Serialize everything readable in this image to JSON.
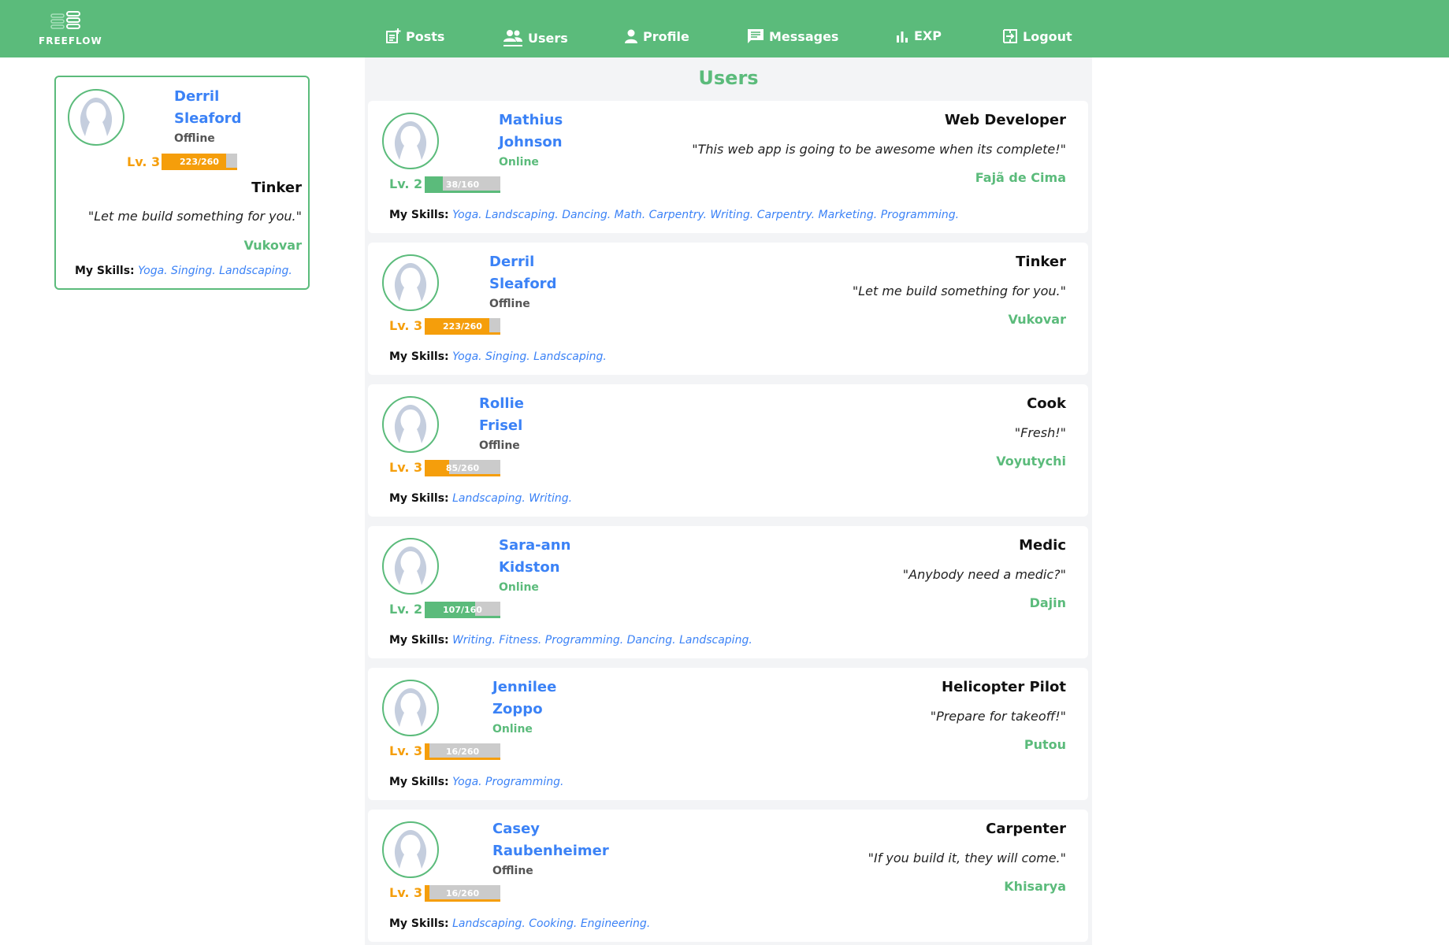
{
  "app": {
    "logo_text": "FREEFLOW"
  },
  "nav": [
    {
      "label": "Posts",
      "icon": "post-add-icon"
    },
    {
      "label": "Users",
      "icon": "users-icon"
    },
    {
      "label": "Profile",
      "icon": "person-icon"
    },
    {
      "label": "Messages",
      "icon": "message-icon"
    },
    {
      "label": "EXP",
      "icon": "bar-chart-icon"
    },
    {
      "label": "Logout",
      "icon": "logout-icon"
    }
  ],
  "current_user": {
    "first": "Derril",
    "last": "Sleaford",
    "status": "Offline",
    "level": "Lv. 3",
    "xp": "223/260",
    "xp_fraction": 0.858,
    "xp_color": "#f59e0b",
    "job": "Tinker",
    "quote": "\"Let me build something for you.\"",
    "city": "Vukovar",
    "skills_label": "My Skills:",
    "skills": "Yoga. Singing. Landscaping."
  },
  "main": {
    "title": "Users"
  },
  "users": [
    {
      "first": "Mathius",
      "last": "Johnson",
      "status": "Online",
      "level": "Lv. 2",
      "xp": "38/160",
      "xp_fraction": 0.24,
      "xp_color": "#5bbb7b",
      "job": "Web Developer",
      "quote": "\"This web app is going to be awesome when its complete!\"",
      "city": "Fajã de Cima",
      "skills_label": "My Skills:",
      "skills": "Yoga. Landscaping. Dancing. Math. Carpentry. Writing. Carpentry. Marketing. Programming."
    },
    {
      "first": "Derril",
      "last": "Sleaford",
      "status": "Offline",
      "level": "Lv. 3",
      "xp": "223/260",
      "xp_fraction": 0.858,
      "xp_color": "#f59e0b",
      "job": "Tinker",
      "quote": "\"Let me build something for you.\"",
      "city": "Vukovar",
      "skills_label": "My Skills:",
      "skills": "Yoga. Singing. Landscaping."
    },
    {
      "first": "Rollie",
      "last": "Frisel",
      "status": "Offline",
      "level": "Lv. 3",
      "xp": "85/260",
      "xp_fraction": 0.327,
      "xp_color": "#f59e0b",
      "job": "Cook",
      "quote": "\"Fresh!\"",
      "city": "Voyutychi",
      "skills_label": "My Skills:",
      "skills": "Landscaping. Writing."
    },
    {
      "first": "Sara-ann",
      "last": "Kidston",
      "status": "Online",
      "level": "Lv. 2",
      "xp": "107/160",
      "xp_fraction": 0.669,
      "xp_color": "#5bbb7b",
      "job": "Medic",
      "quote": "\"Anybody need a medic?\"",
      "city": "Dajin",
      "skills_label": "My Skills:",
      "skills": "Writing. Fitness. Programming. Dancing. Landscaping."
    },
    {
      "first": "Jennilee",
      "last": "Zoppo",
      "status": "Online",
      "level": "Lv. 3",
      "xp": "16/260",
      "xp_fraction": 0.062,
      "xp_color": "#f59e0b",
      "job": "Helicopter Pilot",
      "quote": "\"Prepare for takeoff!\"",
      "city": "Putou",
      "skills_label": "My Skills:",
      "skills": "Yoga. Programming."
    },
    {
      "first": "Casey",
      "last": "Raubenheimer",
      "status": "Offline",
      "level": "Lv. 3",
      "xp": "16/260",
      "xp_fraction": 0.062,
      "xp_color": "#f59e0b",
      "job": "Carpenter",
      "quote": "\"If you build it, they will come.\"",
      "city": "Khisarya",
      "skills_label": "My Skills:",
      "skills": "Landscaping. Cooking. Engineering."
    }
  ]
}
